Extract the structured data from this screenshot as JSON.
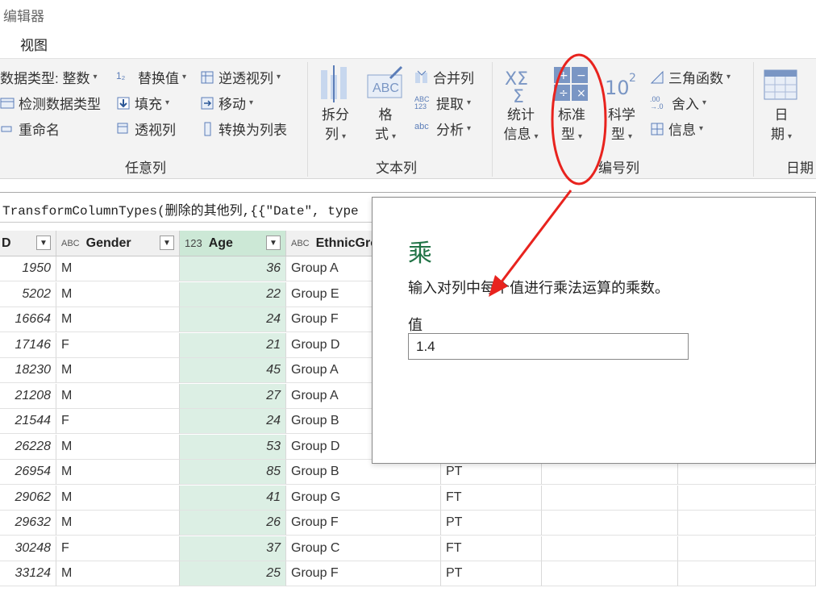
{
  "window": {
    "title": "编辑器"
  },
  "menu": {
    "view": "视图"
  },
  "ribbon": {
    "any_column": {
      "group_label": "任意列",
      "data_type": "数据类型: 整数",
      "detect_type": "检测数据类型",
      "rename": "重命名",
      "replace_values": "替换值",
      "fill": "填充",
      "pivot_column": "透视列",
      "unpivot_columns": "逆透视列",
      "move": "移动",
      "convert_to_list": "转换为列表"
    },
    "text_column": {
      "group_label": "文本列",
      "split_1": "拆分",
      "split_2": "列",
      "format_1": "格",
      "format_2": "式",
      "merge_columns": "合并列",
      "extract": "提取",
      "parse": "分析"
    },
    "number_column": {
      "group_label": "编号列",
      "statistics_1": "统计",
      "statistics_2": "信息",
      "standard_1": "标准",
      "standard_2": "型",
      "scientific_1": "科学",
      "scientific_2": "型",
      "trigonometry": "三角函数",
      "rounding": "舍入",
      "information": "信息"
    },
    "date_column": {
      "group_label": "日期",
      "date_1": "日",
      "date_2": "期"
    }
  },
  "formula_bar": {
    "text": "TransformColumnTypes(删除的其他列,{{\"Date\", type"
  },
  "table": {
    "col0_header": "D",
    "headers": [
      {
        "type_icon": "ABC",
        "name": "Gender"
      },
      {
        "type_icon": "123",
        "name": "Age"
      },
      {
        "type_icon": "ABC",
        "name": "EthnicGro"
      }
    ],
    "rows": [
      {
        "id": "1950",
        "gender": "M",
        "age": "36",
        "group": "Group A",
        "status": ""
      },
      {
        "id": "5202",
        "gender": "M",
        "age": "22",
        "group": "Group E",
        "status": ""
      },
      {
        "id": "16664",
        "gender": "M",
        "age": "24",
        "group": "Group F",
        "status": ""
      },
      {
        "id": "17146",
        "gender": "F",
        "age": "21",
        "group": "Group D",
        "status": ""
      },
      {
        "id": "18230",
        "gender": "M",
        "age": "45",
        "group": "Group A",
        "status": ""
      },
      {
        "id": "21208",
        "gender": "M",
        "age": "27",
        "group": "Group A",
        "status": ""
      },
      {
        "id": "21544",
        "gender": "F",
        "age": "24",
        "group": "Group B",
        "status": ""
      },
      {
        "id": "26228",
        "gender": "M",
        "age": "53",
        "group": "Group D",
        "status": ""
      },
      {
        "id": "26954",
        "gender": "M",
        "age": "85",
        "group": "Group B",
        "status": "PT"
      },
      {
        "id": "29062",
        "gender": "M",
        "age": "41",
        "group": "Group G",
        "status": "FT"
      },
      {
        "id": "29632",
        "gender": "M",
        "age": "26",
        "group": "Group F",
        "status": "PT"
      },
      {
        "id": "30248",
        "gender": "F",
        "age": "37",
        "group": "Group C",
        "status": "FT"
      },
      {
        "id": "33124",
        "gender": "M",
        "age": "25",
        "group": "Group F",
        "status": "PT"
      }
    ]
  },
  "dialog": {
    "title": "乘",
    "description": "输入对列中每个值进行乘法运算的乘数。",
    "value_label": "值",
    "value": "1.4"
  },
  "colors": {
    "accent_green": "#217346",
    "age_column_bg": "#dcefe4",
    "annotation_red": "#e8231e"
  }
}
